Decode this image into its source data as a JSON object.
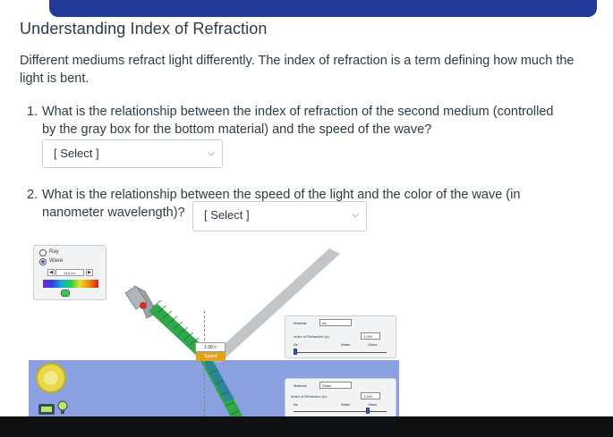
{
  "header": {
    "title": "Understanding Index of Refraction"
  },
  "intro": "Different mediums refract light differently.  The index of refraction is a term defining how much the light is bent.",
  "questions": [
    {
      "num": "1.",
      "text": "What is the relationship between the index of refraction of the second medium (controlled by the gray box for the bottom material) and the speed of the wave?",
      "select_label": "[ Select ]"
    },
    {
      "num": "2.",
      "text": "What is the relationship between the speed of the light and the color of the wave (in",
      "text_cont": "nanometer wavelength)?",
      "select_label": "[ Select ]"
    }
  ],
  "sim": {
    "radio_ray": "Ray",
    "radio_wave": "Wave",
    "wavelength": "510 nm",
    "top_material_label": "Material:",
    "top_material_value": "Air",
    "top_index_label": "Index of Refraction (n):",
    "top_index_value": "1.000",
    "top_slider_labels": [
      "Air",
      "Water",
      "Glass"
    ],
    "bottom_material_label": "Material:",
    "bottom_material_value": "Glass",
    "bottom_index_label": "Index of Refraction (n):",
    "bottom_index_value": "1.500",
    "bottom_slider_labels": [
      "Air",
      "Water",
      "Glass"
    ],
    "speed_value": "1.00 c",
    "speed_label": "Speed",
    "colors": {
      "bottom_medium": "#8aa0e0",
      "wave_green": "#2fa84a",
      "laser_red": "#d03030",
      "header_blue": "#243a9b"
    }
  }
}
